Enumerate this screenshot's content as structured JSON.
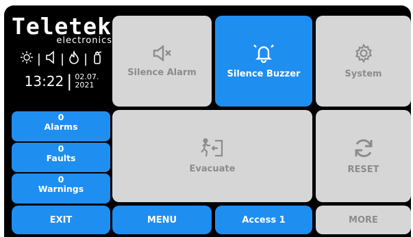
{
  "brand": {
    "name": "Teletek",
    "sub": "electronics"
  },
  "clock": {
    "time": "13:22",
    "date_line1": "02.07.",
    "date_line2": "2021"
  },
  "indicators": [
    "sun-icon",
    "speaker-icon",
    "fire-icon",
    "extinguisher-icon"
  ],
  "tiles": {
    "silence_alarm": {
      "label": "Silence Alarm",
      "icon": "speaker-mute-icon"
    },
    "silence_buzzer": {
      "label": "Silence Buzzer",
      "icon": "bell-icon"
    },
    "system": {
      "label": "System",
      "icon": "gear-icon"
    },
    "evacuate": {
      "label": "Evacuate",
      "icon": "evacuate-exit-icon"
    },
    "reset": {
      "label": "RESET",
      "icon": "refresh-icon"
    }
  },
  "status": [
    {
      "count": "0",
      "label": "Alarms"
    },
    {
      "count": "0",
      "label": "Faults"
    },
    {
      "count": "0",
      "label": "Warnings"
    }
  ],
  "bottom": {
    "exit": "EXIT",
    "menu": "MENU",
    "access": "Access 1",
    "more": "MORE"
  },
  "colors": {
    "accent": "#1f8ef1",
    "disabled": "#d6d6d6",
    "background": "#000000"
  }
}
